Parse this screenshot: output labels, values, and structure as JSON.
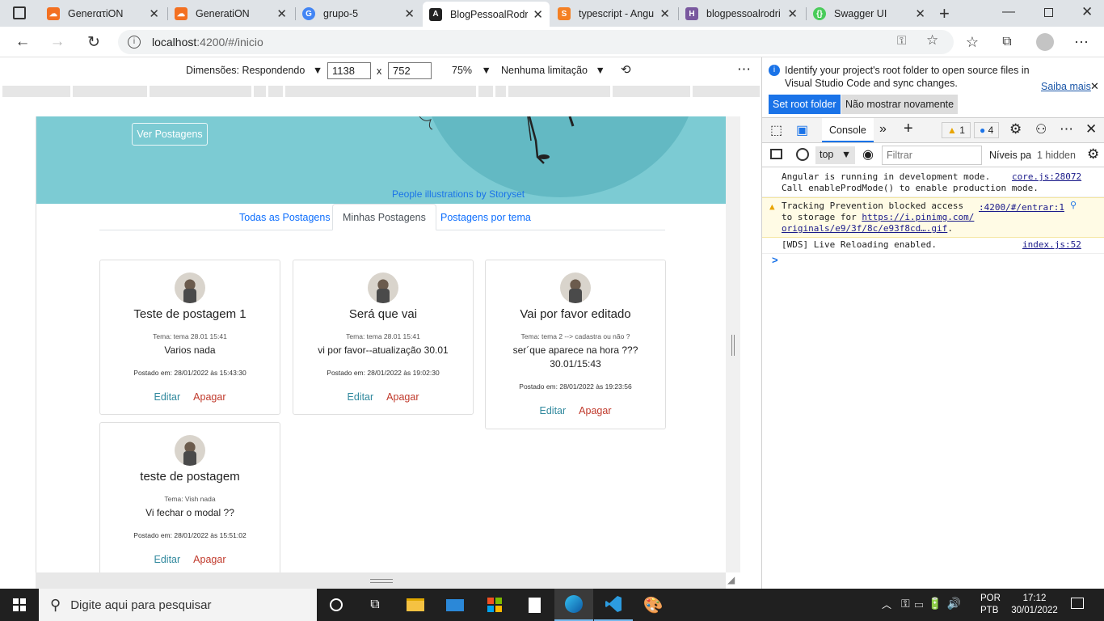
{
  "browser": {
    "tabs": [
      {
        "label": "GenerατiON",
        "icon": "cloud-icon",
        "color": "#f37021"
      },
      {
        "label": "GeneratiON",
        "icon": "cloud-icon",
        "color": "#f37021"
      },
      {
        "label": "grupo-5",
        "icon": "google-icon",
        "color": "#4285f4"
      },
      {
        "label": "BlogPessoalRodri",
        "icon": "angular-icon",
        "color": "#222222"
      },
      {
        "label": "typescript - Angu",
        "icon": "stackoverflow-icon",
        "color": "#f48024"
      },
      {
        "label": "blogpessoalrodri",
        "icon": "heroku-icon",
        "color": "#79589f"
      },
      {
        "label": "Swagger UI",
        "icon": "swagger-icon",
        "color": "#49cc5a"
      }
    ],
    "url_host": "localhost",
    "url_rest": ":4200/#/inicio"
  },
  "device_toolbar": {
    "dimensions_label": "Dimensões: Respondendo",
    "width": "1138",
    "height": "752",
    "times": "x",
    "zoom": "75%",
    "throttle": "Nenhuma limitação"
  },
  "page": {
    "hero_button": "Ver Postagens",
    "credit": "People illustrations by Storyset",
    "tabs": [
      "Todas as Postagens",
      "Minhas Postagens",
      "Postagens por tema"
    ],
    "posts": [
      {
        "title": "Teste de postagem 1",
        "theme": "Tema: tema 28.01 15:41",
        "text": "Varios nada",
        "date": "Postado em: 28/01/2022 às 15:43:30",
        "edit": "Editar",
        "delete": "Apagar"
      },
      {
        "title": "Será que vai",
        "theme": "Tema: tema 28.01 15:41",
        "text": "vi por favor--atualização 30.01",
        "date": "Postado em: 28/01/2022 às 19:02:30",
        "edit": "Editar",
        "delete": "Apagar"
      },
      {
        "title": "Vai por favor editado",
        "theme": "Tema: tema 2 --> cadastra ou não ?",
        "text": "ser´que aparece na hora ??? 30.01/15:43",
        "date": "Postado em: 28/01/2022 às 19:23:56",
        "edit": "Editar",
        "delete": "Apagar"
      },
      {
        "title": "teste de postagem",
        "theme": "Tema: Vish nada",
        "text": "Vi fechar o modal ??",
        "date": "Postado em: 28/01/2022 às 15:51:02",
        "edit": "Editar",
        "delete": "Apagar"
      }
    ]
  },
  "devtools": {
    "info_text": "Identify your project's root folder to open source files in Visual Studio Code and sync changes.",
    "learn_more": "Saiba mais",
    "set_root": "Set root folder",
    "dont_show": "Não mostrar novamente",
    "console_tab": "Console",
    "warn_count": "1",
    "msg_count": "4",
    "context": "top",
    "filter_placeholder": "Filtrar",
    "levels": "Níveis pac",
    "hidden": "1 hidden",
    "messages": [
      {
        "text1": "Angular is running in development mode.",
        "text2": "Call enableProdMode() to enable production mode.",
        "source": "core.js:28072"
      },
      {
        "text1": "Tracking Prevention blocked access",
        "text2": "to storage for",
        "link": "https://i.pinimg.com/",
        "text3": "originals/e9/3f/8c/e93f8cd….gif",
        "text3_tail": ".",
        "source": ":4200/#/entrar:1"
      },
      {
        "text1": "[WDS] Live Reloading enabled.",
        "source": "index.js:52"
      }
    ],
    "prompt": ">"
  },
  "taskbar": {
    "search_placeholder": "Digite aqui para pesquisar",
    "lang1": "POR",
    "lang2": "PTB",
    "time": "17:12",
    "date": "30/01/2022"
  }
}
